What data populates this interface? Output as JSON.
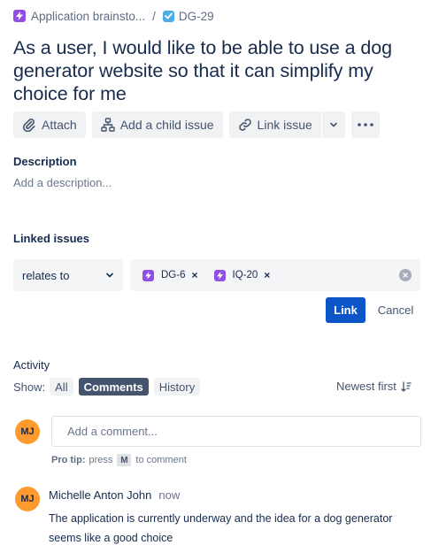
{
  "breadcrumb": {
    "parent_label": "Application brainsto...",
    "separator": "/",
    "issue_key": "DG-29",
    "parent_icon": "epic-lightning-icon",
    "issue_icon": "task-check-icon"
  },
  "issue": {
    "title": "As a user, I would like to be able to use a dog generator website so that it can simplify my choice for me"
  },
  "toolbar": {
    "attach_label": "Attach",
    "add_child_label": "Add a child issue",
    "link_issue_label": "Link issue",
    "icons": [
      "paperclip-icon",
      "hierarchy-icon",
      "link-icon",
      "chevron-down-icon",
      "more-icon"
    ]
  },
  "description": {
    "label": "Description",
    "placeholder": "Add a description..."
  },
  "linked_issues": {
    "label": "Linked issues",
    "relation": "relates to",
    "selected": [
      {
        "key": "DG-6"
      },
      {
        "key": "IQ-20"
      }
    ],
    "link_button": "Link",
    "cancel_button": "Cancel"
  },
  "activity": {
    "label": "Activity",
    "show_label": "Show:",
    "filters": [
      "All",
      "Comments",
      "History"
    ],
    "active_filter": "Comments",
    "sort_label": "Newest first"
  },
  "comment_input": {
    "avatar_initials": "MJ",
    "placeholder": "Add a comment...",
    "protip_label": "Pro tip:",
    "protip_press": "press",
    "protip_key": "M",
    "protip_suffix": "to comment"
  },
  "comments": [
    {
      "avatar_initials": "MJ",
      "author": "Michelle Anton John",
      "time": "now",
      "text": "The application is currently underway and the idea for a dog generator seems like a good choice"
    }
  ],
  "colors": {
    "epic": "#904ee2",
    "task": "#4bade8",
    "primary": "#0c55c9",
    "avatar": "#ff9a2e",
    "active_filter": "#44546f"
  }
}
